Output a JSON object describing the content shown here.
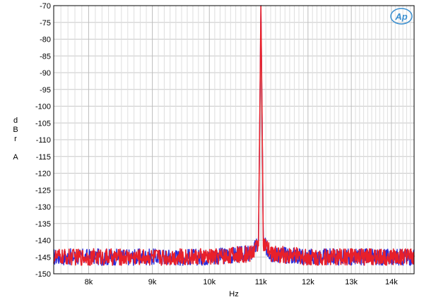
{
  "chart_data": {
    "type": "line",
    "title": "",
    "xlabel": "Hz",
    "ylabel_lines": [
      "d",
      "B",
      "r",
      "",
      "A"
    ],
    "xlim": [
      7500,
      14600
    ],
    "ylim": [
      -150,
      -70
    ],
    "x_scale": "log",
    "grid": true,
    "x_major_ticks": [
      8000,
      9000,
      10000,
      11000,
      12000,
      13000,
      14000
    ],
    "x_tick_labels": [
      "8k",
      "9k",
      "10k",
      "11k",
      "12k",
      "13k",
      "14k"
    ],
    "y_ticks": [
      -70,
      -75,
      -80,
      -85,
      -90,
      -95,
      -100,
      -105,
      -110,
      -115,
      -120,
      -125,
      -130,
      -135,
      -140,
      -145,
      -150
    ],
    "y_tick_labels": [
      "-70",
      "-75",
      "-80",
      "-85",
      "-90",
      "-95",
      "-100",
      "-105",
      "-110",
      "-115",
      "-120",
      "-125",
      "-130",
      "-135",
      "-140",
      "-145",
      "-150"
    ],
    "series": [
      {
        "color": "#2b2bd9",
        "x": [
          7500,
          8000,
          9000,
          10000,
          10800,
          10950,
          11000,
          11050,
          11200,
          12000,
          13000,
          14000,
          14600
        ],
        "y": [
          -145,
          -145,
          -145,
          -145,
          -144,
          -141,
          -70,
          -141,
          -144,
          -145,
          -145,
          -145,
          -145
        ]
      },
      {
        "color": "#e8202a",
        "x": [
          7500,
          8000,
          9000,
          10000,
          10800,
          10950,
          11000,
          11050,
          11200,
          12000,
          13000,
          14000,
          14600
        ],
        "y": [
          -145,
          -145,
          -145,
          -145,
          -144,
          -141,
          -70,
          -141,
          -144,
          -145,
          -145,
          -145,
          -145
        ]
      }
    ]
  },
  "logo": {
    "text": "Ap",
    "color": "#3a8fd0"
  }
}
